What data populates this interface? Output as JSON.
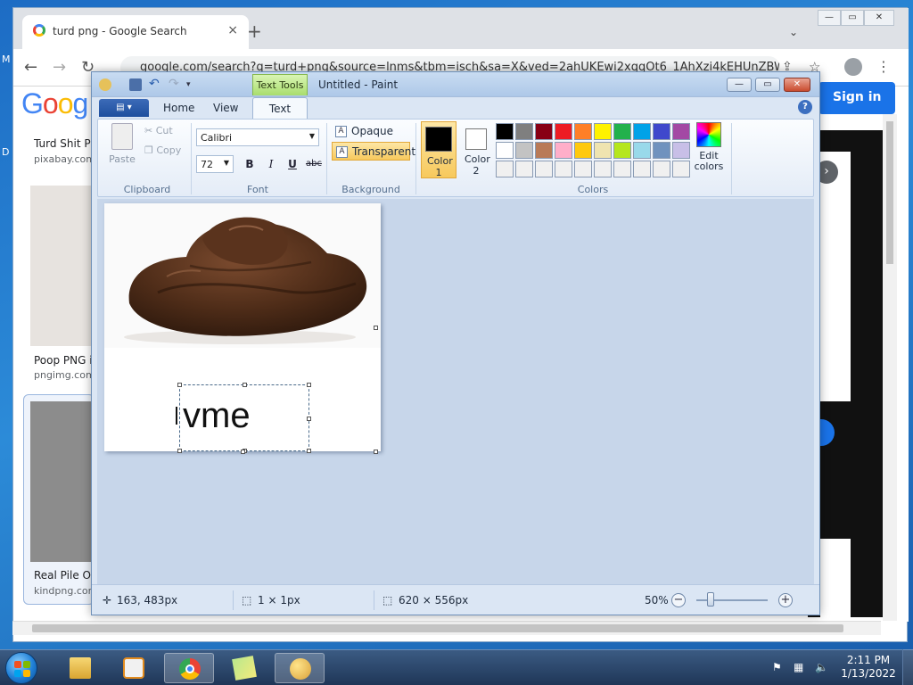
{
  "desktop": {
    "edge_label_1": "M",
    "edge_label_2": "D"
  },
  "chrome": {
    "tab_title": "turd png - Google Search",
    "tab_close": "×",
    "new_tab": "+",
    "url": "google.com/search?q=turd+png&source=lnms&tbm=isch&sa=X&ved=2ahUKEwi2xqqOt6_1AhXzi4kEHUnZBWc...",
    "logo": "Goog",
    "sign_in": "Sign in",
    "results": [
      {
        "title": "Turd Shit Pi",
        "site": "pixabay.com"
      },
      {
        "title": "Poop PNG i",
        "site": "pngimg.com"
      },
      {
        "title": "Real Pile Of",
        "site": "kindpng.com"
      }
    ]
  },
  "paint": {
    "title": "Untitled - Paint",
    "context_tab": "Text Tools",
    "tabs": [
      "Home",
      "View",
      "Text"
    ],
    "active_tab": "Text",
    "clipboard": {
      "paste": "Paste",
      "cut": "Cut",
      "copy": "Copy",
      "label": "Clipboard"
    },
    "font": {
      "family": "Calibri",
      "size": "72",
      "bold": "B",
      "italic": "I",
      "underline": "U",
      "strike": "abc",
      "label": "Font"
    },
    "background": {
      "opaque": "Opaque",
      "transparent": "Transparent",
      "label": "Background"
    },
    "colors": {
      "color1_label": "Color 1",
      "color1": "#000000",
      "color2_label": "Color 2",
      "color2": "#ffffff",
      "edit_label": "Edit colors",
      "label": "Colors",
      "palette": [
        "#000000",
        "#7f7f7f",
        "#880015",
        "#ed1c24",
        "#ff7f27",
        "#fff200",
        "#22b14c",
        "#00a2e8",
        "#3f48cc",
        "#a349a4",
        "#ffffff",
        "#c3c3c3",
        "#b97a57",
        "#ffaec9",
        "#ffc90e",
        "#efe4b0",
        "#b5e61d",
        "#99d9ea",
        "#7092be",
        "#c8bfe7",
        "#f0f0f0",
        "#f0f0f0",
        "#f0f0f0",
        "#f0f0f0",
        "#f0f0f0",
        "#f0f0f0",
        "#f0f0f0",
        "#f0f0f0",
        "#f0f0f0",
        "#f0f0f0"
      ]
    },
    "canvas": {
      "typed_text": "vme"
    },
    "status": {
      "cursor": "163, 483px",
      "selection": "1 × 1px",
      "size": "620 × 556px",
      "zoom": "50%",
      "zoom_level": 0.2
    }
  },
  "taskbar": {
    "time": "2:11 PM",
    "date": "1/13/2022"
  }
}
